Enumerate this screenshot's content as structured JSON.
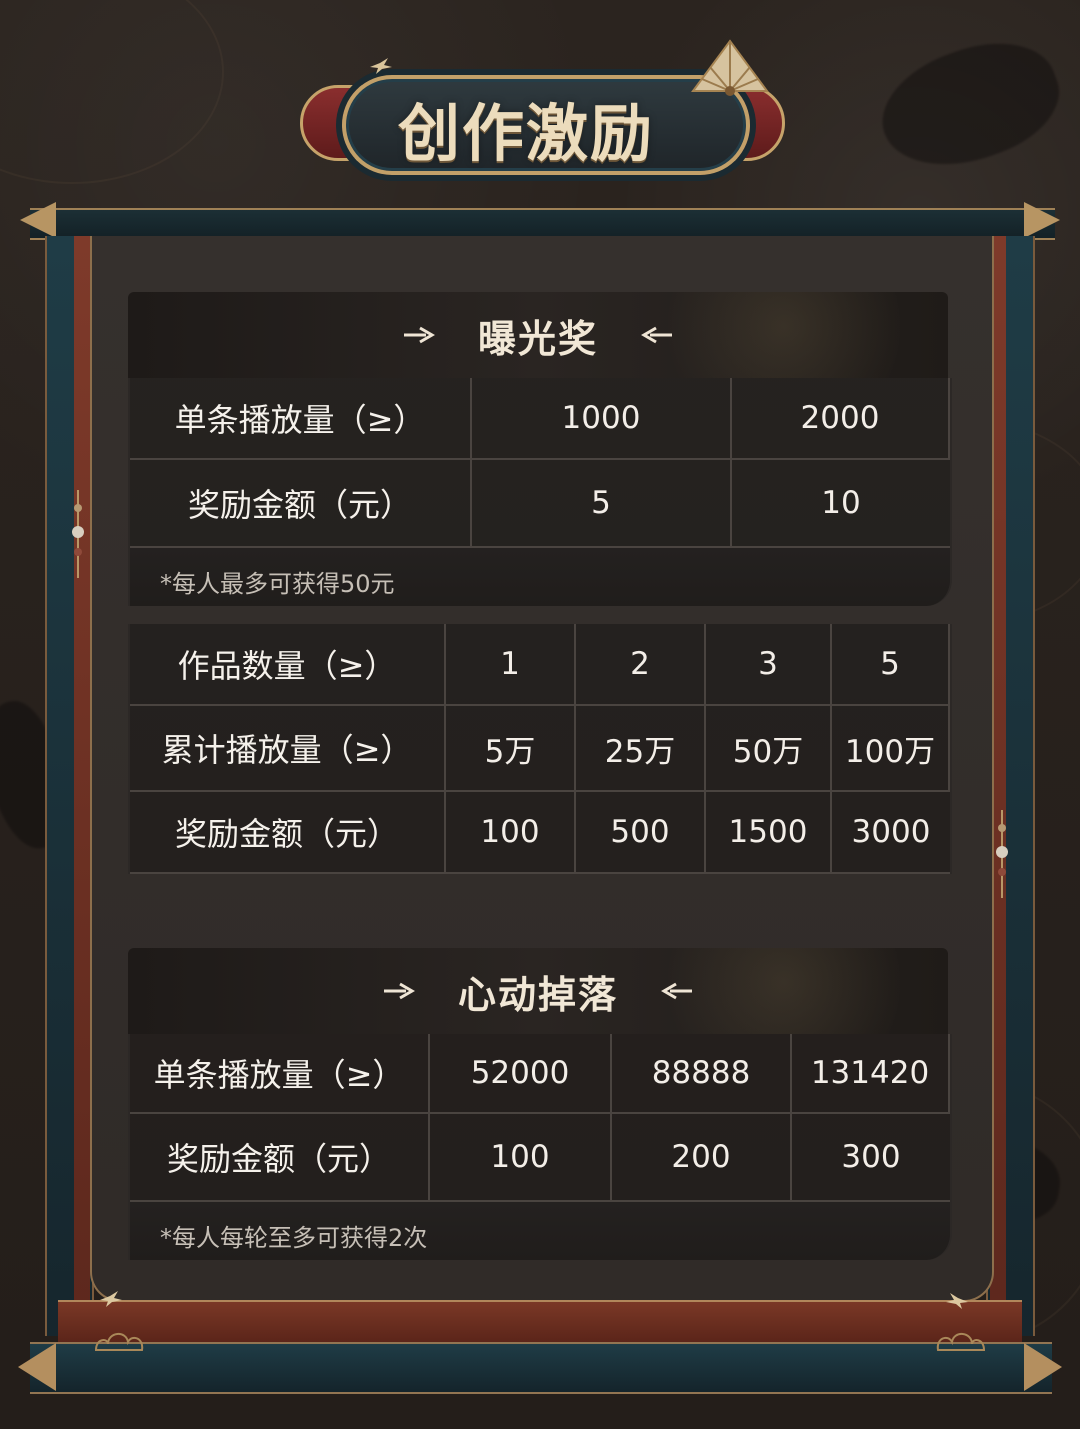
{
  "title": "创作激励",
  "sections": {
    "exposure": {
      "title": "曝光奖",
      "table1": {
        "rows": [
          {
            "label": "单条播放量（≥）",
            "values": [
              "1000",
              "2000"
            ]
          },
          {
            "label": "奖励金额（元）",
            "values": [
              "5",
              "10"
            ]
          }
        ]
      },
      "note1": "*每人最多可获得50元",
      "table2": {
        "rows": [
          {
            "label": "作品数量（≥）",
            "values": [
              "1",
              "2",
              "3",
              "5"
            ]
          },
          {
            "label": "累计播放量（≥）",
            "values": [
              "5万",
              "25万",
              "50万",
              "100万"
            ]
          },
          {
            "label": "奖励金额（元）",
            "values": [
              "100",
              "500",
              "1500",
              "3000"
            ]
          }
        ]
      }
    },
    "heart": {
      "title": "心动掉落",
      "table": {
        "rows": [
          {
            "label": "单条播放量（≥）",
            "values": [
              "52000",
              "88888",
              "131420"
            ]
          },
          {
            "label": "奖励金额（元）",
            "values": [
              "100",
              "200",
              "300"
            ]
          }
        ]
      },
      "note": "*每人每轮至多可获得2次"
    }
  },
  "icons": {
    "fan": "fan-icon",
    "arrow_right": "arrow-right-icon",
    "arrow_left": "arrow-left-icon",
    "swallow": "swallow-icon",
    "charm": "charm-icon"
  },
  "colors": {
    "gold": "#c6a36a",
    "teal": "#1f3c46",
    "red": "#7a3826",
    "panel": "#312c29",
    "text": "#f3eee8"
  }
}
